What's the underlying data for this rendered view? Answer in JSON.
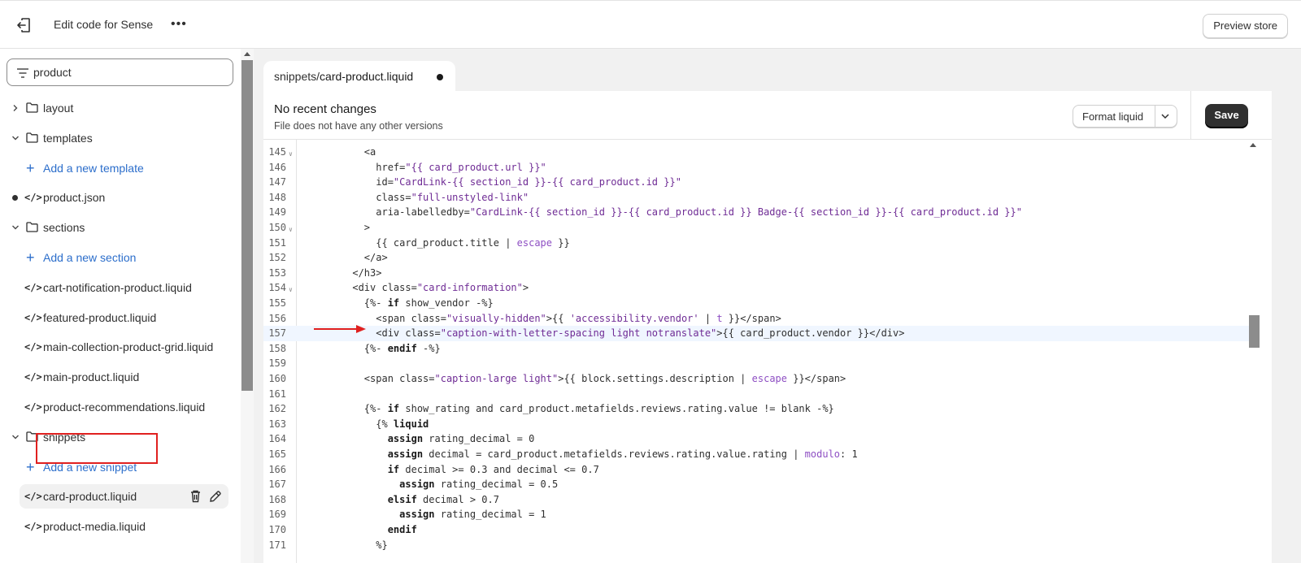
{
  "header": {
    "title": "Edit code for Sense",
    "more_label": "•••",
    "preview_label": "Preview store"
  },
  "sidebar": {
    "search_value": "product",
    "items": [
      {
        "type": "folder",
        "label": "layout",
        "expanded": false
      },
      {
        "type": "folder",
        "label": "templates",
        "expanded": true
      },
      {
        "type": "add",
        "label": "Add a new template"
      },
      {
        "type": "file",
        "label": "product.json",
        "modified": true
      },
      {
        "type": "folder",
        "label": "sections",
        "expanded": true
      },
      {
        "type": "add",
        "label": "Add a new section"
      },
      {
        "type": "file",
        "label": "cart-notification-product.liquid"
      },
      {
        "type": "file",
        "label": "featured-product.liquid"
      },
      {
        "type": "file",
        "label": "main-collection-product-grid.liquid"
      },
      {
        "type": "file",
        "label": "main-product.liquid"
      },
      {
        "type": "file",
        "label": "product-recommendations.liquid"
      },
      {
        "type": "folder",
        "label": "snippets",
        "expanded": true
      },
      {
        "type": "add",
        "label": "Add a new snippet"
      },
      {
        "type": "file",
        "label": "card-product.liquid",
        "selected": true
      },
      {
        "type": "file",
        "label": "product-media.liquid"
      }
    ],
    "code_icon": "</>"
  },
  "editor": {
    "tab": {
      "prefix": "snippets/",
      "name": "card-product.liquid"
    },
    "status_title": "No recent changes",
    "status_sub": "File does not have any other versions",
    "format_label": "Format liquid",
    "save_label": "Save",
    "lines": [
      {
        "n": "145",
        "fold": true,
        "tokens": [
          [
            "p",
            "        <a"
          ]
        ]
      },
      {
        "n": "146",
        "tokens": [
          [
            "p",
            "          href="
          ],
          [
            "s",
            "\"{{ card_product.url }}\""
          ]
        ]
      },
      {
        "n": "147",
        "tokens": [
          [
            "p",
            "          id="
          ],
          [
            "s",
            "\"CardLink-{{ section_id }}-{{ card_product.id }}\""
          ]
        ]
      },
      {
        "n": "148",
        "tokens": [
          [
            "p",
            "          class="
          ],
          [
            "s",
            "\"full-unstyled-link\""
          ]
        ]
      },
      {
        "n": "149",
        "tokens": [
          [
            "p",
            "          aria-labelledby="
          ],
          [
            "s",
            "\"CardLink-{{ section_id }}-{{ card_product.id }} Badge-{{ section_id }}-{{ card_product.id }}\""
          ]
        ]
      },
      {
        "n": "150",
        "fold": true,
        "tokens": [
          [
            "p",
            "        >"
          ]
        ]
      },
      {
        "n": "151",
        "tokens": [
          [
            "p",
            "          {{ card_product.title | "
          ],
          [
            "f",
            "escape"
          ],
          [
            "p",
            " }}"
          ]
        ]
      },
      {
        "n": "152",
        "tokens": [
          [
            "p",
            "        </a>"
          ]
        ]
      },
      {
        "n": "153",
        "tokens": [
          [
            "p",
            "      </h3>"
          ]
        ]
      },
      {
        "n": "154",
        "fold": true,
        "tokens": [
          [
            "p",
            "      <div class="
          ],
          [
            "s",
            "\"card-information\""
          ],
          [
            "p",
            ">"
          ]
        ]
      },
      {
        "n": "155",
        "tokens": [
          [
            "p",
            "        {%- "
          ],
          [
            "k",
            "if"
          ],
          [
            "p",
            " show_vendor -%}"
          ]
        ]
      },
      {
        "n": "156",
        "tokens": [
          [
            "p",
            "          <span class="
          ],
          [
            "s",
            "\"visually-hidden\""
          ],
          [
            "p",
            ">{{ "
          ],
          [
            "s",
            "'accessibility.vendor'"
          ],
          [
            "p",
            " | "
          ],
          [
            "f",
            "t"
          ],
          [
            "p",
            " }}</span>"
          ]
        ]
      },
      {
        "n": "157",
        "active": true,
        "tokens": [
          [
            "p",
            "          <div class="
          ],
          [
            "s",
            "\"caption-with-letter-spacing light notranslate\""
          ],
          [
            "p",
            ">{{ card_product.vendor }}</div>"
          ]
        ]
      },
      {
        "n": "158",
        "tokens": [
          [
            "p",
            "        {%- "
          ],
          [
            "k",
            "endif"
          ],
          [
            "p",
            " -%}"
          ]
        ]
      },
      {
        "n": "159",
        "tokens": [
          [
            "p",
            ""
          ]
        ]
      },
      {
        "n": "160",
        "tokens": [
          [
            "p",
            "        <span class="
          ],
          [
            "s",
            "\"caption-large light\""
          ],
          [
            "p",
            ">{{ block.settings.description | "
          ],
          [
            "f",
            "escape"
          ],
          [
            "p",
            " }}</span>"
          ]
        ]
      },
      {
        "n": "161",
        "tokens": [
          [
            "p",
            ""
          ]
        ]
      },
      {
        "n": "162",
        "tokens": [
          [
            "p",
            "        {%- "
          ],
          [
            "k",
            "if"
          ],
          [
            "p",
            " show_rating and card_product.metafields.reviews.rating.value != blank -%}"
          ]
        ]
      },
      {
        "n": "163",
        "tokens": [
          [
            "p",
            "          {% "
          ],
          [
            "k",
            "liquid"
          ]
        ]
      },
      {
        "n": "164",
        "tokens": [
          [
            "p",
            "            "
          ],
          [
            "k",
            "assign"
          ],
          [
            "p",
            " rating_decimal = 0"
          ]
        ]
      },
      {
        "n": "165",
        "tokens": [
          [
            "p",
            "            "
          ],
          [
            "k",
            "assign"
          ],
          [
            "p",
            " decimal = card_product.metafields.reviews.rating.value.rating | "
          ],
          [
            "f",
            "modulo"
          ],
          [
            "p",
            ": 1"
          ]
        ]
      },
      {
        "n": "166",
        "tokens": [
          [
            "p",
            "            "
          ],
          [
            "k",
            "if"
          ],
          [
            "p",
            " decimal >= 0.3 and decimal <= 0.7"
          ]
        ]
      },
      {
        "n": "167",
        "tokens": [
          [
            "p",
            "              "
          ],
          [
            "k",
            "assign"
          ],
          [
            "p",
            " rating_decimal = 0.5"
          ]
        ]
      },
      {
        "n": "168",
        "tokens": [
          [
            "p",
            "            "
          ],
          [
            "k",
            "elsif"
          ],
          [
            "p",
            " decimal > 0.7"
          ]
        ]
      },
      {
        "n": "169",
        "tokens": [
          [
            "p",
            "              "
          ],
          [
            "k",
            "assign"
          ],
          [
            "p",
            " rating_decimal = 1"
          ]
        ]
      },
      {
        "n": "170",
        "tokens": [
          [
            "p",
            "            "
          ],
          [
            "k",
            "endif"
          ]
        ]
      },
      {
        "n": "171",
        "tokens": [
          [
            "p",
            "          %}"
          ]
        ]
      }
    ]
  },
  "icons": {
    "back": "exit-icon",
    "filter": "filter-icon",
    "folder": "folder-icon",
    "chevron": "chevron-icon",
    "delete": "trash-icon",
    "rename": "pencil-icon",
    "arrow": "red-arrow-icon"
  },
  "colors": {
    "highlight": "#e0201f",
    "link": "#2c6ecb",
    "string": "#6f2c95",
    "active_line": "#f0f6ff"
  }
}
